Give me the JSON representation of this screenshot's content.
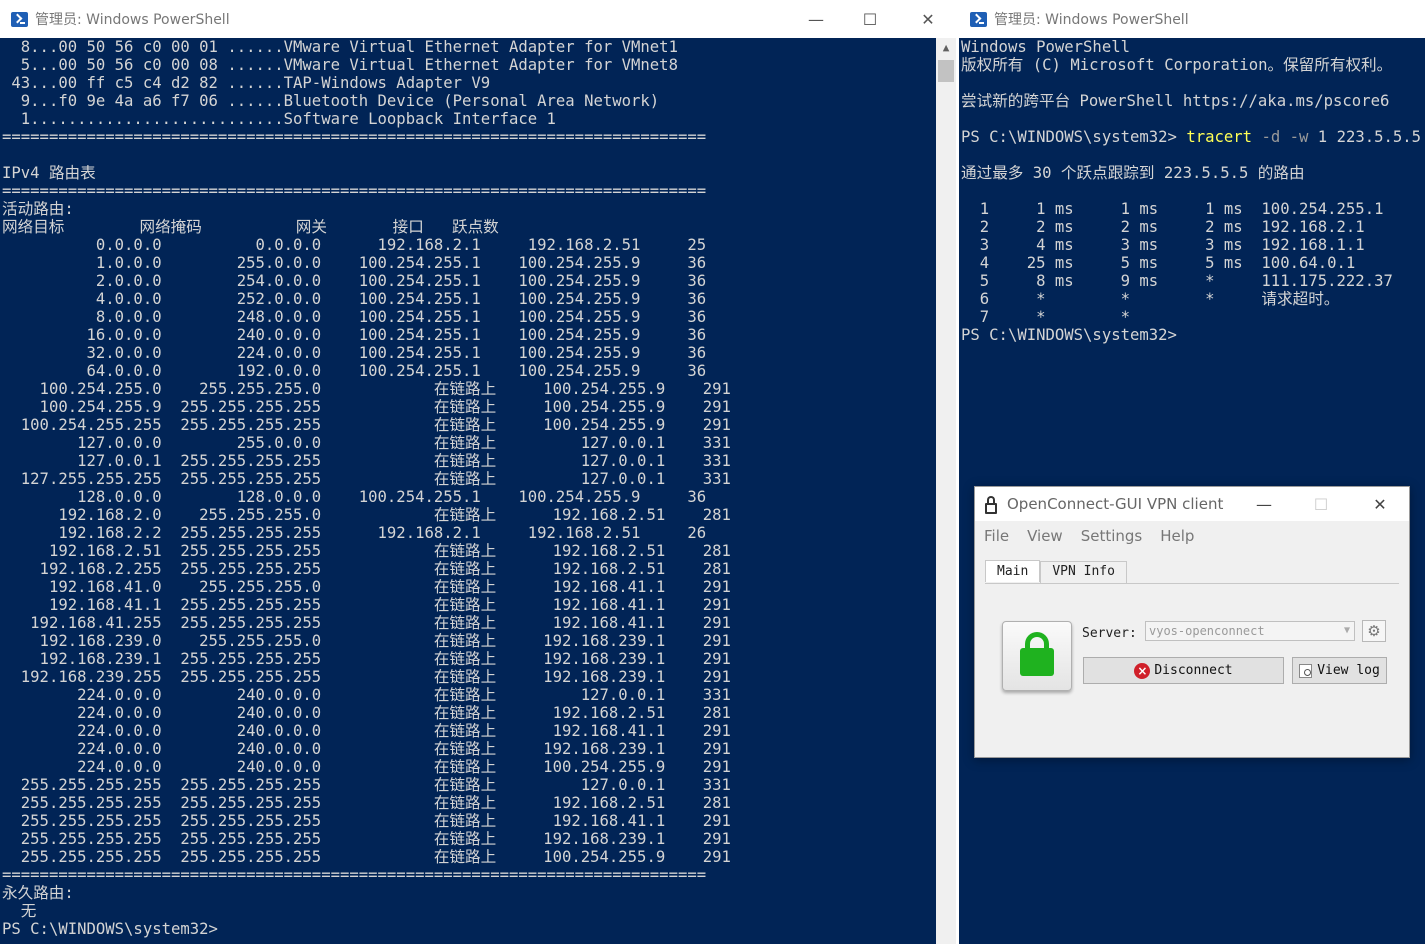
{
  "left_window": {
    "title": "管理员: Windows PowerShell",
    "minimize": "—",
    "maximize": "☐",
    "close": "✕",
    "lines": [
      "  8...00 50 56 c0 00 01 ......VMware Virtual Ethernet Adapter for VMnet1",
      "  5...00 50 56 c0 00 08 ......VMware Virtual Ethernet Adapter for VMnet8",
      " 43...00 ff c5 c4 d2 82 ......TAP-Windows Adapter V9",
      "  9...f0 9e 4a a6 f7 06 ......Bluetooth Device (Personal Area Network)",
      "  1...........................Software Loopback Interface 1",
      "===========================================================================",
      "",
      "IPv4 路由表",
      "===========================================================================",
      "活动路由:",
      "网络目标        网络掩码          网关       接口   跃点数",
      "          0.0.0.0          0.0.0.0      192.168.2.1     192.168.2.51     25",
      "          1.0.0.0        255.0.0.0    100.254.255.1    100.254.255.9     36",
      "          2.0.0.0        254.0.0.0    100.254.255.1    100.254.255.9     36",
      "          4.0.0.0        252.0.0.0    100.254.255.1    100.254.255.9     36",
      "          8.0.0.0        248.0.0.0    100.254.255.1    100.254.255.9     36",
      "         16.0.0.0        240.0.0.0    100.254.255.1    100.254.255.9     36",
      "         32.0.0.0        224.0.0.0    100.254.255.1    100.254.255.9     36",
      "         64.0.0.0        192.0.0.0    100.254.255.1    100.254.255.9     36",
      "    100.254.255.0    255.255.255.0            在链路上     100.254.255.9    291",
      "    100.254.255.9  255.255.255.255            在链路上     100.254.255.9    291",
      "  100.254.255.255  255.255.255.255            在链路上     100.254.255.9    291",
      "        127.0.0.0        255.0.0.0            在链路上         127.0.0.1    331",
      "        127.0.0.1  255.255.255.255            在链路上         127.0.0.1    331",
      "  127.255.255.255  255.255.255.255            在链路上         127.0.0.1    331",
      "        128.0.0.0        128.0.0.0    100.254.255.1    100.254.255.9     36",
      "      192.168.2.0    255.255.255.0            在链路上      192.168.2.51    281",
      "      192.168.2.2  255.255.255.255      192.168.2.1     192.168.2.51     26",
      "     192.168.2.51  255.255.255.255            在链路上      192.168.2.51    281",
      "    192.168.2.255  255.255.255.255            在链路上      192.168.2.51    281",
      "     192.168.41.0    255.255.255.0            在链路上      192.168.41.1    291",
      "     192.168.41.1  255.255.255.255            在链路上      192.168.41.1    291",
      "   192.168.41.255  255.255.255.255            在链路上      192.168.41.1    291",
      "    192.168.239.0    255.255.255.0            在链路上     192.168.239.1    291",
      "    192.168.239.1  255.255.255.255            在链路上     192.168.239.1    291",
      "  192.168.239.255  255.255.255.255            在链路上     192.168.239.1    291",
      "        224.0.0.0        240.0.0.0            在链路上         127.0.0.1    331",
      "        224.0.0.0        240.0.0.0            在链路上      192.168.2.51    281",
      "        224.0.0.0        240.0.0.0            在链路上      192.168.41.1    291",
      "        224.0.0.0        240.0.0.0            在链路上     192.168.239.1    291",
      "        224.0.0.0        240.0.0.0            在链路上     100.254.255.9    291",
      "  255.255.255.255  255.255.255.255            在链路上         127.0.0.1    331",
      "  255.255.255.255  255.255.255.255            在链路上      192.168.2.51    281",
      "  255.255.255.255  255.255.255.255            在链路上      192.168.41.1    291",
      "  255.255.255.255  255.255.255.255            在链路上     192.168.239.1    291",
      "  255.255.255.255  255.255.255.255            在链路上     100.254.255.9    291",
      "===========================================================================",
      "永久路由:",
      "  无",
      "PS C:\\WINDOWS\\system32>"
    ]
  },
  "right_window": {
    "title": "管理员: Windows PowerShell",
    "lines_top": [
      "Windows PowerShell",
      "版权所有 (C) Microsoft Corporation。保留所有权利。",
      "",
      "尝试新的跨平台 PowerShell https://aka.ms/pscore6",
      ""
    ],
    "prompt": "PS C:\\WINDOWS\\system32> ",
    "cmd": "tracert",
    "flag_d": "-d",
    "flag_w": "-w",
    "args_w": "1",
    "target": "223.5.5.5",
    "lines_bottom": [
      "",
      "通过最多 30 个跃点跟踪到 223.5.5.5 的路由",
      "",
      "  1     1 ms     1 ms     1 ms  100.254.255.1",
      "  2     2 ms     2 ms     2 ms  192.168.2.1",
      "  3     4 ms     3 ms     3 ms  192.168.1.1",
      "  4    25 ms     5 ms     5 ms  100.64.0.1",
      "  5     8 ms     9 ms     *     111.175.222.37",
      "  6     *        *        *     请求超时。",
      "  7     *        *",
      "PS C:\\WINDOWS\\system32>"
    ]
  },
  "vpn": {
    "title": "OpenConnect-GUI VPN client",
    "menu": [
      "File",
      "View",
      "Settings",
      "Help"
    ],
    "tabs": [
      "Main",
      "VPN Info"
    ],
    "server_label": "Server:",
    "server_value": "vyos-openconnect",
    "disconnect_label": "Disconnect",
    "viewlog_label": "View log",
    "lock_color": "#1fb21f"
  }
}
